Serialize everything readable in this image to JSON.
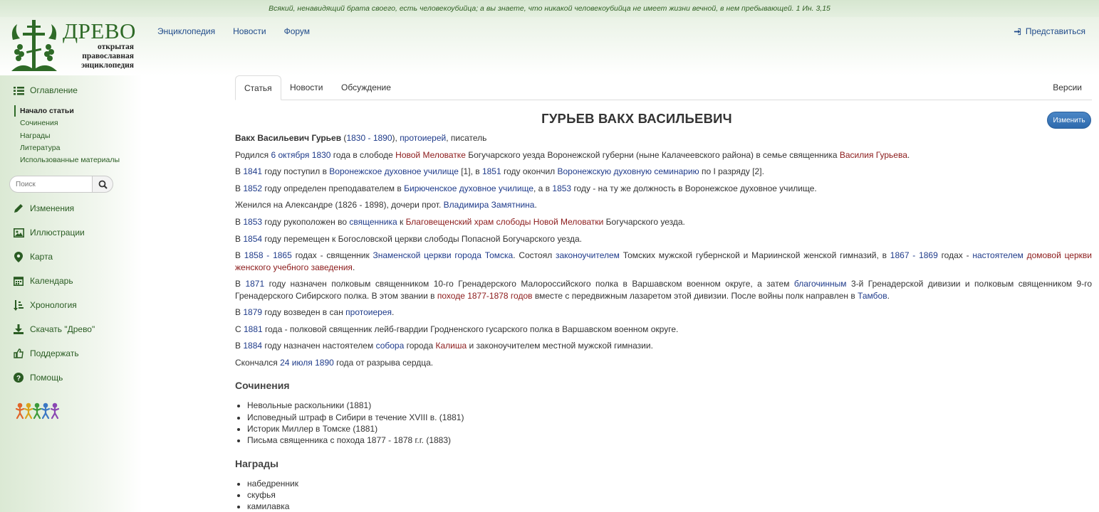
{
  "quote": "Всякий, ненавидящий брата своего, есть человекоубийца; а вы знаете, что никакой человекоубийца не имеет жизни вечной, в нем пребывающей. 1 Ин. 3,15",
  "logo": {
    "title": "ДРЕВО",
    "sub1": "открытая",
    "sub2": "православная",
    "sub3": "энциклопедия"
  },
  "topnav": {
    "encyclopedia": "Энциклопедия",
    "news": "Новости",
    "forum": "Форум"
  },
  "login": "Представиться",
  "sidebar": {
    "contents": "Оглавление",
    "toc": [
      "Начало статьи",
      "Сочинения",
      "Награды",
      "Литература",
      "Использованные материалы"
    ],
    "search_placeholder": "Поиск",
    "items": [
      "Изменения",
      "Иллюстрации",
      "Карта",
      "Календарь",
      "Хронология",
      "Скачать \"Древо\"",
      "Поддержать",
      "Помощь"
    ]
  },
  "tabs": {
    "article": "Статья",
    "news": "Новости",
    "discussion": "Обсуждение",
    "versions": "Версии"
  },
  "title": "ГУРЬЕВ ВАКХ ВАСИЛЬЕВИЧ",
  "edit": "Изменить",
  "article": {
    "p1": {
      "name": "Вакх Васильевич Гурьев",
      "a": " (",
      "y1": "1830",
      "b": " - ",
      "y2": "1890",
      "c": "), ",
      "prot": "протоиерей",
      "d": ", писатель"
    },
    "p2": {
      "a": "Родился ",
      "date": "6 октября",
      "b": " ",
      "year": "1830",
      "c": " года в слободе ",
      "place": "Новой Меловатке",
      "d": " Богучарского уезда Воронежской губерни (ныне Калачеевского района) в семье священника ",
      "father": "Василия Гурьева",
      "e": "."
    },
    "p3": {
      "a": "В ",
      "y1": "1841",
      "b": " году поступил в ",
      "school": "Воронежское духовное училище",
      "c": " [1], в ",
      "y2": "1851",
      "d": " году окончил ",
      "sem": "Воронежскую духовную семинарию",
      "e": " по I разряду [2]."
    },
    "p4": {
      "a": "В ",
      "y1": "1852",
      "b": " году определен преподавателем в ",
      "school": "Бирюченское духовное училище",
      "c": ", а в ",
      "y2": "1853",
      "d": " году - на ту же должность в Воронежское духовное училище."
    },
    "p5": {
      "a": "Женился на Александре (1826 - 1898), дочери прот. ",
      "name": "Владимира Замятнина",
      "b": "."
    },
    "p6": {
      "a": "В ",
      "y": "1853",
      "b": " году рукоположен во ",
      "priest": "священника",
      "c": " к ",
      "church": "Благовещенский храм слободы",
      "d": " ",
      "place": "Новой Меловатки",
      "e": " Богучарского уезда."
    },
    "p7": {
      "a": "В ",
      "y": "1854",
      "b": " году перемещен к Богословской церкви слободы Попасной Богучарского уезда."
    },
    "p8": {
      "a": "В ",
      "y1": "1858",
      "b": " - ",
      "y2": "1865",
      "c": " годах - священник ",
      "church": "Знаменской церкви города Томска",
      "d": ". Состоял ",
      "teacher": "законоучителем",
      "e": " Томских мужской губернской и Мариинской женской гимназий, в ",
      "y3": "1867",
      "f": " - ",
      "y4": "1869",
      "g": " годах - ",
      "rector": "настоятелем",
      "h": " ",
      "home": "домовой церкви женского учебного заведения",
      "i": "."
    },
    "p9": {
      "a": "В ",
      "y": "1871",
      "b": " году назначен полковым священником 10-го Гренадерского Малороссийского полка в Варшавском военном округе, а затем ",
      "blag": "благочинным",
      "c": " 3-й Гренадерской дивизии и полковым священником 9-го Гренадерского Сибирского полка. В этом звании в ",
      "campaign": "походе 1877-1878 годов",
      "d": " вместе с передвижным лазаретом этой дивизии. После войны полк направлен в ",
      "city": "Тамбов",
      "e": "."
    },
    "p10": {
      "a": "В ",
      "y": "1879",
      "b": " году возведен в сан ",
      "prot": "протоиерея",
      "c": "."
    },
    "p11": {
      "a": "С ",
      "y": "1881",
      "b": " года - полковой священник лейб-гвардии Гродненского гусарского полка в Варшавском военном округе."
    },
    "p12": {
      "a": "В ",
      "y": "1884",
      "b": " году назначен настоятелем ",
      "cath": "собора",
      "c": " города ",
      "city": "Калиша",
      "d": " и законоучителем местной мужской гимназии."
    },
    "p13": {
      "a": "Скончался ",
      "date": "24 июля",
      "b": " ",
      "y": "1890",
      "c": " года от разрыва сердца."
    },
    "works_title": "Сочинения",
    "works": [
      "Невольные раскольники (1881)",
      "Исповедный штраф в Сибири в течение XVIII в. (1881)",
      "Историк Миллер в Томске (1881)",
      "Письма священника с похода 1877 - 1878 г.г. (1883)"
    ],
    "awards_title": "Награды",
    "awards": [
      "набедренник",
      "скуфья",
      "камилавка"
    ]
  }
}
